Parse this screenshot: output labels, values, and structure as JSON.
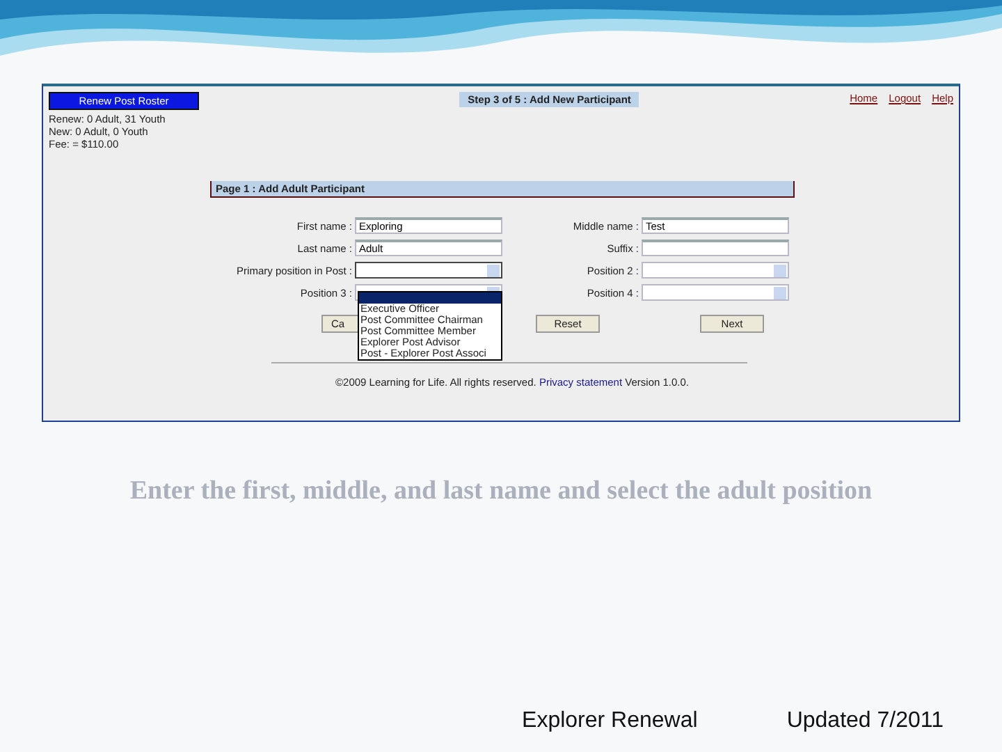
{
  "slide": {
    "screenshot": {
      "roster_button": "Renew Post Roster",
      "stats": [
        "Renew: 0 Adult, 31 Youth",
        "New: 0 Adult, 0 Youth",
        "Fee: = $110.00"
      ],
      "step": "Step 3 of 5 : Add New Participant",
      "links": [
        "Home",
        "Logout",
        "Help"
      ],
      "panel_title": "Page 1 : Add Adult Participant",
      "fields": [
        {
          "label": "First name :",
          "kind": "text",
          "value": "Exploring"
        },
        {
          "label": "Middle name :",
          "kind": "text",
          "value": "Test"
        },
        {
          "label": "Last name :",
          "kind": "text",
          "value": "Adult"
        },
        {
          "label": "Suffix :",
          "kind": "text"
        },
        {
          "label": "Primary position in Post :",
          "kind": "select",
          "expanded": true
        },
        {
          "label": "Position 2 :",
          "kind": "select",
          "expanded": false
        },
        {
          "label": "Position 3 :",
          "kind": "select",
          "expanded": false
        },
        {
          "label": "Position 4 :",
          "kind": "select",
          "expanded": false
        }
      ],
      "dropdown_options": [
        {
          "selected": true
        },
        {
          "label": "Executive Officer",
          "selected": false
        },
        {
          "label": "Post Committee Chairman",
          "selected": false
        },
        {
          "label": "Post Committee Member",
          "selected": false
        },
        {
          "label": "Explorer Post Advisor",
          "selected": false
        },
        {
          "label": "Post - Explorer Post Associ",
          "selected": false
        }
      ],
      "buttons": [
        "Ca",
        "Reset",
        "Next"
      ],
      "copyright": "©2009 Learning for Life. All rights reserved.",
      "privacy_link": "Privacy statement",
      "version": "Version 1.0.0."
    },
    "caption": "Enter the first, middle, and last name and select the adult position",
    "footer": [
      "Explorer Renewal",
      "Updated 7/2011"
    ]
  }
}
